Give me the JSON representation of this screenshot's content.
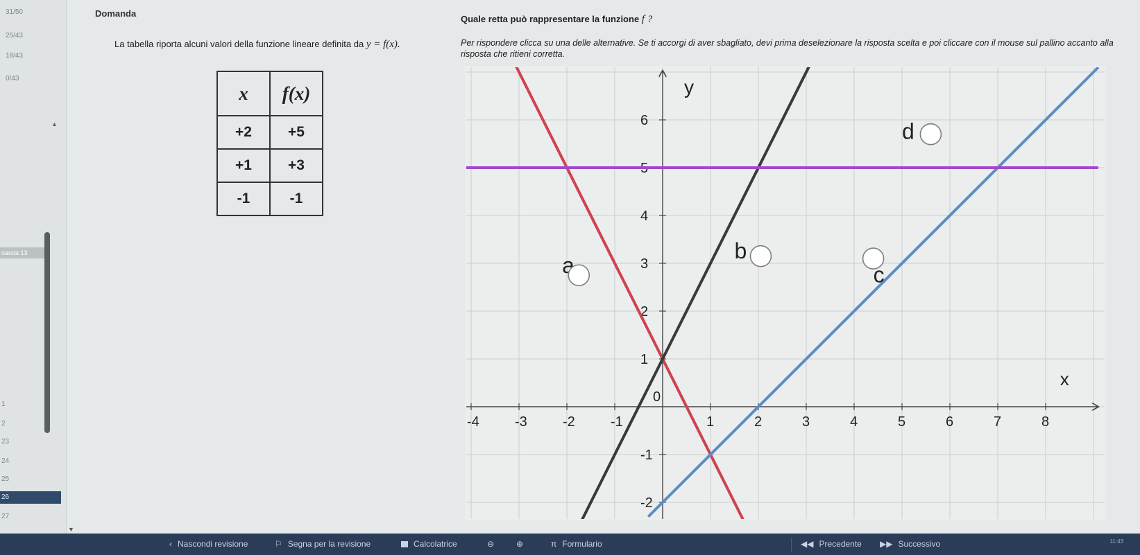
{
  "sidebar": {
    "items": [
      "31/50",
      "25/43",
      "18/43",
      "0/43"
    ],
    "tag": "nanda 13",
    "numbers": [
      "1",
      "2",
      "23",
      "24",
      "25"
    ],
    "active": "26",
    "below": "27"
  },
  "question": {
    "section_label": "Domanda",
    "intro_text": "La tabella riporta alcuni valori della funzione lineare definita da",
    "intro_formula": "y = f(x).",
    "table": {
      "headers": [
        "x",
        "f(x)"
      ],
      "rows": [
        [
          "+2",
          "+5"
        ],
        [
          "+1",
          "+3"
        ],
        [
          "-1",
          "-1"
        ]
      ]
    },
    "title_text": "Quale retta può rappresentare la funzione",
    "title_symbol": "f ?",
    "instructions": "Per rispondere clicca su una delle alternative. Se ti accorgi di aver sbagliato, devi prima deselezionare la risposta scelta e poi cliccare con il mouse sul pallino accanto alla risposta che ritieni corretta."
  },
  "graph": {
    "axis_x_label": "x",
    "axis_y_label": "y",
    "x_ticks": [
      "-4",
      "-3",
      "-2",
      "-1",
      "0",
      "1",
      "2",
      "3",
      "4",
      "5",
      "6",
      "7",
      "8"
    ],
    "y_ticks": [
      "6",
      "5",
      "4",
      "3",
      "2",
      "1",
      "-1",
      "-2"
    ],
    "origin_label": "0",
    "options": [
      {
        "label": "a",
        "color": "#d0424f"
      },
      {
        "label": "b",
        "color": "#3a3a3a"
      },
      {
        "label": "c",
        "color": "#5b8ec7"
      },
      {
        "label": "d",
        "color": "#a248c9"
      }
    ]
  },
  "footer": {
    "hide_review": "Nascondi revisione",
    "mark_review": "Segna per la revisione",
    "calculator": "Calcolatrice",
    "formulary": "Formulario",
    "previous": "Precedente",
    "next": "Successivo",
    "clock": "11:43"
  }
}
